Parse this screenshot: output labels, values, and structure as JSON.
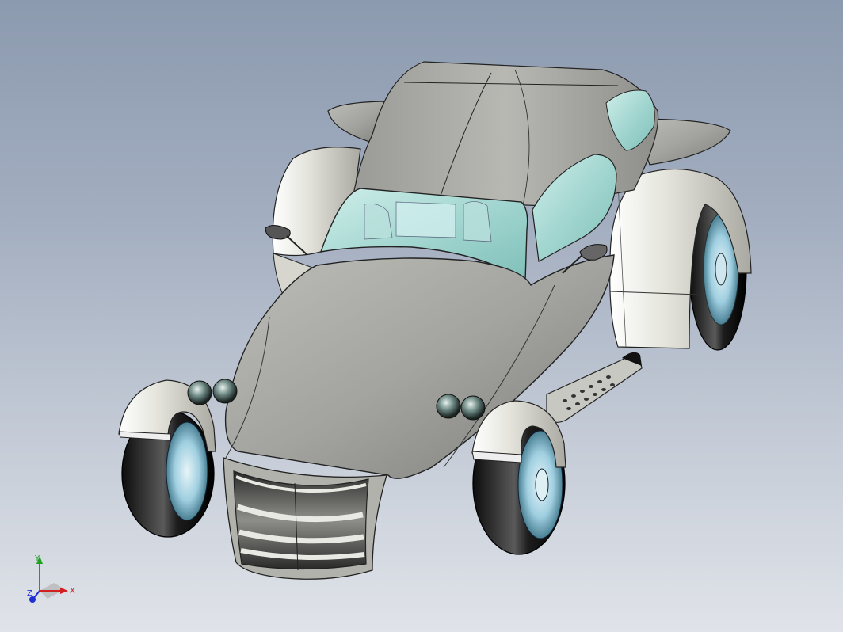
{
  "viewport": {
    "background_top": "#8c9aaf",
    "background_bottom": "#e0e3e9"
  },
  "model": {
    "body_color": "#a7a7a3",
    "glass_color": "#a8d8d4",
    "fender_color": "#d9d9d2",
    "tire_color": "#1c1c1c",
    "rim_color": "#8fc4d6"
  },
  "triad": {
    "x_label": "X",
    "y_label": "Y",
    "z_label": "Z",
    "x_color": "#d02020",
    "y_color": "#20a020",
    "z_color": "#2030d0"
  }
}
